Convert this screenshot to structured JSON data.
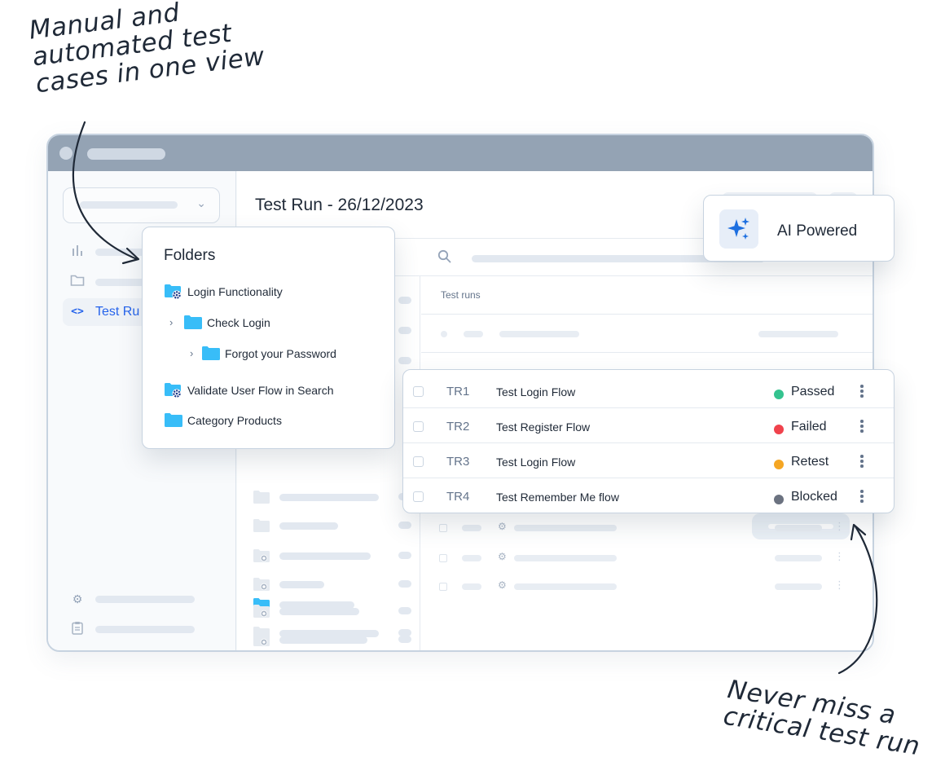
{
  "annotations": {
    "top_lines": [
      "Manual and",
      "automated test",
      "cases in one view"
    ],
    "bottom_lines": [
      "Never miss a",
      "critical test run"
    ]
  },
  "sidebar": {
    "active_item_label": "Test Ru"
  },
  "page_title": "Test Run - 26/12/2023",
  "runs_column_header": "Test runs",
  "folders_popup": {
    "title": "Folders",
    "items": [
      {
        "label": "Login Functionality",
        "icon": "folder-gear-icon"
      },
      {
        "label": "Check Login",
        "icon": "folder-icon"
      },
      {
        "label": "Forgot your Password",
        "icon": "folder-icon"
      },
      {
        "label": "Validate User Flow in Search",
        "icon": "folder-gear-icon"
      },
      {
        "label": "Category Products",
        "icon": "folder-icon"
      }
    ]
  },
  "ai_badge": {
    "label": "AI Powered",
    "icon": "sparkle-icon"
  },
  "test_runs": [
    {
      "id": "TR1",
      "name": "Test Login Flow",
      "status": "Passed",
      "status_color": "#34c38f"
    },
    {
      "id": "TR2",
      "name": "Test Register Flow",
      "status": "Failed",
      "status_color": "#f0424c"
    },
    {
      "id": "TR3",
      "name": "Test Login Flow",
      "status": "Retest",
      "status_color": "#f5a623"
    },
    {
      "id": "TR4",
      "name": "Test Remember Me flow",
      "status": "Blocked",
      "status_color": "#6b7280"
    }
  ],
  "colors": {
    "accent": "#2563eb",
    "folder": "#38bdf8",
    "titlebar": "#94a3b4"
  }
}
